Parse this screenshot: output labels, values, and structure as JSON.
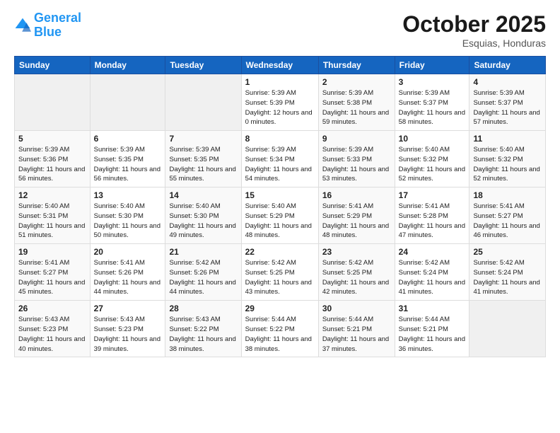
{
  "header": {
    "logo_line1": "General",
    "logo_line2": "Blue",
    "month": "October 2025",
    "location": "Esquias, Honduras"
  },
  "days": [
    "Sunday",
    "Monday",
    "Tuesday",
    "Wednesday",
    "Thursday",
    "Friday",
    "Saturday"
  ],
  "weeks": [
    [
      {
        "date": "",
        "sunrise": "",
        "sunset": "",
        "daylight": ""
      },
      {
        "date": "",
        "sunrise": "",
        "sunset": "",
        "daylight": ""
      },
      {
        "date": "",
        "sunrise": "",
        "sunset": "",
        "daylight": ""
      },
      {
        "date": "1",
        "sunrise": "Sunrise: 5:39 AM",
        "sunset": "Sunset: 5:39 PM",
        "daylight": "Daylight: 12 hours and 0 minutes."
      },
      {
        "date": "2",
        "sunrise": "Sunrise: 5:39 AM",
        "sunset": "Sunset: 5:38 PM",
        "daylight": "Daylight: 11 hours and 59 minutes."
      },
      {
        "date": "3",
        "sunrise": "Sunrise: 5:39 AM",
        "sunset": "Sunset: 5:37 PM",
        "daylight": "Daylight: 11 hours and 58 minutes."
      },
      {
        "date": "4",
        "sunrise": "Sunrise: 5:39 AM",
        "sunset": "Sunset: 5:37 PM",
        "daylight": "Daylight: 11 hours and 57 minutes."
      }
    ],
    [
      {
        "date": "5",
        "sunrise": "Sunrise: 5:39 AM",
        "sunset": "Sunset: 5:36 PM",
        "daylight": "Daylight: 11 hours and 56 minutes."
      },
      {
        "date": "6",
        "sunrise": "Sunrise: 5:39 AM",
        "sunset": "Sunset: 5:35 PM",
        "daylight": "Daylight: 11 hours and 56 minutes."
      },
      {
        "date": "7",
        "sunrise": "Sunrise: 5:39 AM",
        "sunset": "Sunset: 5:35 PM",
        "daylight": "Daylight: 11 hours and 55 minutes."
      },
      {
        "date": "8",
        "sunrise": "Sunrise: 5:39 AM",
        "sunset": "Sunset: 5:34 PM",
        "daylight": "Daylight: 11 hours and 54 minutes."
      },
      {
        "date": "9",
        "sunrise": "Sunrise: 5:39 AM",
        "sunset": "Sunset: 5:33 PM",
        "daylight": "Daylight: 11 hours and 53 minutes."
      },
      {
        "date": "10",
        "sunrise": "Sunrise: 5:40 AM",
        "sunset": "Sunset: 5:32 PM",
        "daylight": "Daylight: 11 hours and 52 minutes."
      },
      {
        "date": "11",
        "sunrise": "Sunrise: 5:40 AM",
        "sunset": "Sunset: 5:32 PM",
        "daylight": "Daylight: 11 hours and 52 minutes."
      }
    ],
    [
      {
        "date": "12",
        "sunrise": "Sunrise: 5:40 AM",
        "sunset": "Sunset: 5:31 PM",
        "daylight": "Daylight: 11 hours and 51 minutes."
      },
      {
        "date": "13",
        "sunrise": "Sunrise: 5:40 AM",
        "sunset": "Sunset: 5:30 PM",
        "daylight": "Daylight: 11 hours and 50 minutes."
      },
      {
        "date": "14",
        "sunrise": "Sunrise: 5:40 AM",
        "sunset": "Sunset: 5:30 PM",
        "daylight": "Daylight: 11 hours and 49 minutes."
      },
      {
        "date": "15",
        "sunrise": "Sunrise: 5:40 AM",
        "sunset": "Sunset: 5:29 PM",
        "daylight": "Daylight: 11 hours and 48 minutes."
      },
      {
        "date": "16",
        "sunrise": "Sunrise: 5:41 AM",
        "sunset": "Sunset: 5:29 PM",
        "daylight": "Daylight: 11 hours and 48 minutes."
      },
      {
        "date": "17",
        "sunrise": "Sunrise: 5:41 AM",
        "sunset": "Sunset: 5:28 PM",
        "daylight": "Daylight: 11 hours and 47 minutes."
      },
      {
        "date": "18",
        "sunrise": "Sunrise: 5:41 AM",
        "sunset": "Sunset: 5:27 PM",
        "daylight": "Daylight: 11 hours and 46 minutes."
      }
    ],
    [
      {
        "date": "19",
        "sunrise": "Sunrise: 5:41 AM",
        "sunset": "Sunset: 5:27 PM",
        "daylight": "Daylight: 11 hours and 45 minutes."
      },
      {
        "date": "20",
        "sunrise": "Sunrise: 5:41 AM",
        "sunset": "Sunset: 5:26 PM",
        "daylight": "Daylight: 11 hours and 44 minutes."
      },
      {
        "date": "21",
        "sunrise": "Sunrise: 5:42 AM",
        "sunset": "Sunset: 5:26 PM",
        "daylight": "Daylight: 11 hours and 44 minutes."
      },
      {
        "date": "22",
        "sunrise": "Sunrise: 5:42 AM",
        "sunset": "Sunset: 5:25 PM",
        "daylight": "Daylight: 11 hours and 43 minutes."
      },
      {
        "date": "23",
        "sunrise": "Sunrise: 5:42 AM",
        "sunset": "Sunset: 5:25 PM",
        "daylight": "Daylight: 11 hours and 42 minutes."
      },
      {
        "date": "24",
        "sunrise": "Sunrise: 5:42 AM",
        "sunset": "Sunset: 5:24 PM",
        "daylight": "Daylight: 11 hours and 41 minutes."
      },
      {
        "date": "25",
        "sunrise": "Sunrise: 5:42 AM",
        "sunset": "Sunset: 5:24 PM",
        "daylight": "Daylight: 11 hours and 41 minutes."
      }
    ],
    [
      {
        "date": "26",
        "sunrise": "Sunrise: 5:43 AM",
        "sunset": "Sunset: 5:23 PM",
        "daylight": "Daylight: 11 hours and 40 minutes."
      },
      {
        "date": "27",
        "sunrise": "Sunrise: 5:43 AM",
        "sunset": "Sunset: 5:23 PM",
        "daylight": "Daylight: 11 hours and 39 minutes."
      },
      {
        "date": "28",
        "sunrise": "Sunrise: 5:43 AM",
        "sunset": "Sunset: 5:22 PM",
        "daylight": "Daylight: 11 hours and 38 minutes."
      },
      {
        "date": "29",
        "sunrise": "Sunrise: 5:44 AM",
        "sunset": "Sunset: 5:22 PM",
        "daylight": "Daylight: 11 hours and 38 minutes."
      },
      {
        "date": "30",
        "sunrise": "Sunrise: 5:44 AM",
        "sunset": "Sunset: 5:21 PM",
        "daylight": "Daylight: 11 hours and 37 minutes."
      },
      {
        "date": "31",
        "sunrise": "Sunrise: 5:44 AM",
        "sunset": "Sunset: 5:21 PM",
        "daylight": "Daylight: 11 hours and 36 minutes."
      },
      {
        "date": "",
        "sunrise": "",
        "sunset": "",
        "daylight": ""
      }
    ]
  ]
}
